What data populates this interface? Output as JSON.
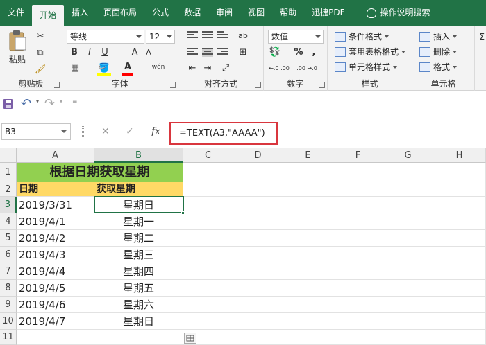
{
  "tabs": [
    "文件",
    "开始",
    "插入",
    "页面布局",
    "公式",
    "数据",
    "审阅",
    "视图",
    "帮助",
    "迅捷PDF"
  ],
  "active_tab_index": 1,
  "tell_me": "操作说明搜索",
  "ribbon": {
    "clipboard": {
      "paste": "粘贴",
      "label": "剪贴板"
    },
    "font": {
      "name": "等线",
      "size": "12",
      "bold": "B",
      "italic": "I",
      "underline": "U",
      "grow": "A",
      "shrink": "A",
      "color_a": "A",
      "phonetic": "wén",
      "label": "字体"
    },
    "alignment": {
      "label": "对齐方式",
      "wrap": "ab"
    },
    "number": {
      "format": "数值",
      "percent": "%",
      "comma": ",",
      "inc": "←.0 .00",
      "dec": ".00 →.0",
      "label": "数字"
    },
    "styles": {
      "conditional": "条件格式",
      "table": "套用表格格式",
      "cell": "单元格样式",
      "label": "样式"
    },
    "cells": {
      "insert": "插入",
      "delete": "删除",
      "format": "格式",
      "label": "单元格"
    }
  },
  "formula_bar": {
    "name_box": "B3",
    "cancel": "✕",
    "enter": "✓",
    "fx": "fx",
    "formula": "=TEXT(A3,\"AAAA\")"
  },
  "columns": [
    "A",
    "B",
    "C",
    "D",
    "E",
    "F",
    "G",
    "H"
  ],
  "rows": [
    "1",
    "2",
    "3",
    "4",
    "5",
    "6",
    "7",
    "8",
    "9",
    "10",
    "11"
  ],
  "sheet": {
    "title": "根据日期获取星期",
    "header_a": "日期",
    "header_b": "获取星期",
    "data": [
      [
        "2019/3/31",
        "星期日"
      ],
      [
        "2019/4/1",
        "星期一"
      ],
      [
        "2019/4/2",
        "星期二"
      ],
      [
        "2019/4/3",
        "星期三"
      ],
      [
        "2019/4/4",
        "星期四"
      ],
      [
        "2019/4/5",
        "星期五"
      ],
      [
        "2019/4/6",
        "星期六"
      ],
      [
        "2019/4/7",
        "星期日"
      ]
    ]
  },
  "colors": {
    "brand": "#217346",
    "title_fill": "#92d050",
    "header_fill": "#ffd966",
    "highlight": "#d9363e"
  }
}
